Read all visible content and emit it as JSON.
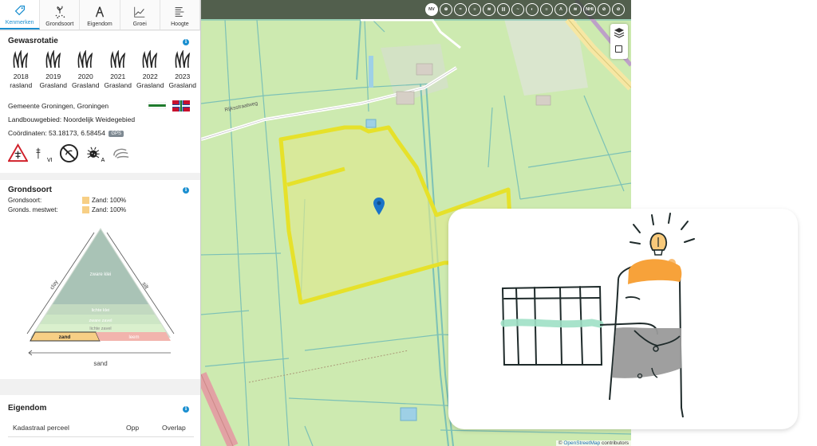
{
  "tabs": [
    {
      "label": "Kenmerken",
      "icon": "tag-icon",
      "active": true
    },
    {
      "label": "Grondsoort",
      "icon": "seedling-icon",
      "active": false
    },
    {
      "label": "Eigendom",
      "icon": "compass-icon",
      "active": false
    },
    {
      "label": "Groei",
      "icon": "growth-chart-icon",
      "active": false
    },
    {
      "label": "Hoogte",
      "icon": "height-lines-icon",
      "active": false
    }
  ],
  "gewasrotatie": {
    "title": "Gewasrotatie",
    "crops": [
      {
        "year": "2018",
        "crop": "rasland"
      },
      {
        "year": "2019",
        "crop": "Grasland"
      },
      {
        "year": "2020",
        "crop": "Grasland"
      },
      {
        "year": "2021",
        "crop": "Grasland"
      },
      {
        "year": "2022",
        "crop": "Grasland"
      },
      {
        "year": "2023",
        "crop": "Grasland"
      }
    ],
    "gemeente": "Gemeente Groningen, Groningen",
    "landbouwgebied": "Landbouwgebied: Noordelijk Weidegebied",
    "coordinaten": "Coördinaten: 53.18173, 6.58454",
    "gps": "GPS",
    "hazards": [
      {
        "icon": "warning-triangle-icon"
      },
      {
        "icon": "power-pole-icon",
        "label": "VI"
      },
      {
        "icon": "no-spray-icon"
      },
      {
        "icon": "bug-icon",
        "label": "A"
      },
      {
        "icon": "swirl-icon"
      }
    ]
  },
  "grondsoort": {
    "title": "Grondsoort",
    "rows": [
      {
        "label": "Grondsoort:",
        "value": "Zand: 100%"
      },
      {
        "label": "Gronds. mestwet:",
        "value": "Zand: 100%"
      }
    ],
    "triangle": {
      "left_label": "clay",
      "right_label": "silt",
      "bottom_label": "sand",
      "layers": [
        "zware klei",
        "lichte klei",
        "zware zavel",
        "lichte zavel"
      ],
      "selected": "zand",
      "other": "leem"
    }
  },
  "eigendom": {
    "title": "Eigendom",
    "columns": [
      "Kadastraal perceel",
      "Opp",
      "Overlap"
    ]
  },
  "map": {
    "toolbar": [
      "NV",
      "⊕",
      "≈",
      "≡",
      "≋",
      "|||",
      "~",
      "◐",
      "≡",
      "Λ",
      "≋",
      "NHI",
      "⊘",
      "⊘"
    ],
    "street": "Rijksstraatweg",
    "attribution_source": "OpenStreetMap",
    "attribution_suffix": " contributors"
  },
  "colors": {
    "accent": "#1a8fd0",
    "parcel_outline": "#e6e12a",
    "map_base": "#cdeab0",
    "water": "#9ed0e6",
    "sand": "#f7cf85"
  }
}
